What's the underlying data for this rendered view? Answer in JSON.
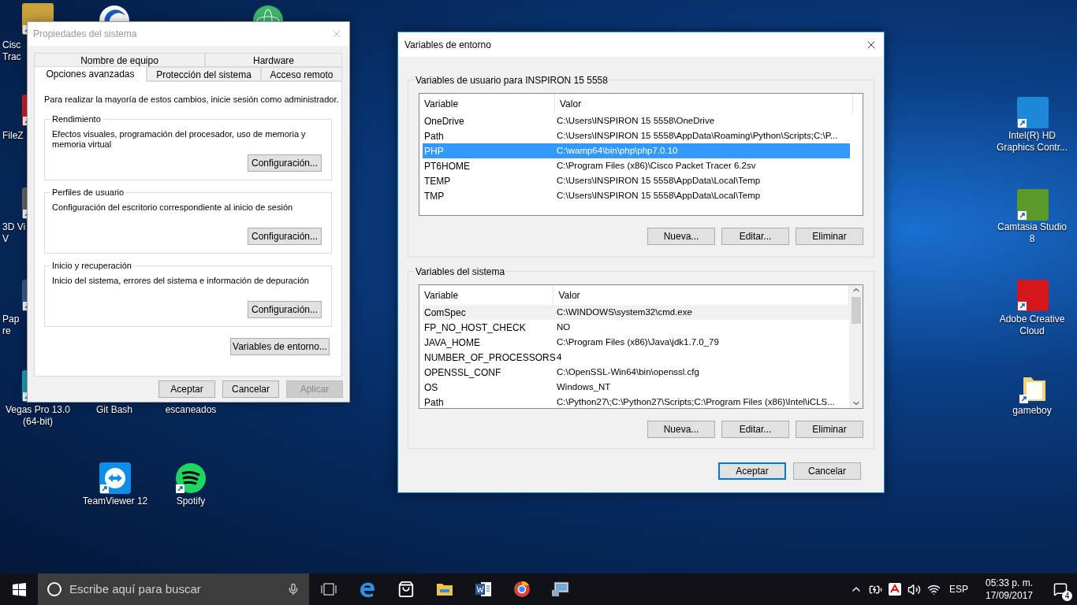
{
  "desktop_icons": [
    {
      "label_lines": [
        "Cisc",
        "Trac"
      ]
    },
    {
      "label_lines": [
        "FileZ"
      ]
    },
    {
      "label_lines": [
        "3D Vi",
        "V"
      ]
    },
    {
      "label_lines": [
        "Pap",
        "re"
      ]
    },
    {
      "label_lines": [
        "Vegas Pro 13.0",
        "(64-bit)"
      ]
    },
    {
      "label_lines": [
        "Git Bash"
      ]
    },
    {
      "label_lines": [
        "escaneados"
      ]
    },
    {
      "label_lines": [
        "TeamViewer 12"
      ]
    },
    {
      "label_lines": [
        "Spotify"
      ]
    },
    {
      "label_lines": [
        "Intel(R) HD",
        "Graphics Contr..."
      ]
    },
    {
      "label_lines": [
        "Camtasia Studio",
        "8"
      ]
    },
    {
      "label_lines": [
        "Adobe Creative",
        "Cloud"
      ]
    },
    {
      "label_lines": [
        "gameboy"
      ]
    }
  ],
  "system_properties": {
    "title": "Propiedades del sistema",
    "active": false,
    "tab_rows": [
      [
        {
          "label": "Nombre de equipo",
          "selected": false
        },
        {
          "label": "Hardware",
          "selected": false
        }
      ],
      [
        {
          "label": "Opciones avanzadas",
          "selected": true
        },
        {
          "label": "Protección del sistema",
          "selected": false
        },
        {
          "label": "Acceso remoto",
          "selected": false
        }
      ]
    ],
    "intro": "Para realizar la mayoría de estos cambios, inicie sesión como administrador.",
    "groups": [
      {
        "title": "Rendimiento",
        "description": "Efectos visuales, programación del procesador, uso de memoria y memoria virtual",
        "button": "Configuración..."
      },
      {
        "title": "Perfiles de usuario",
        "description": "Configuración del escritorio correspondiente al inicio de sesión",
        "button": "Configuración..."
      },
      {
        "title": "Inicio y recuperación",
        "description": "Inicio del sistema, errores del sistema e información de depuración",
        "button": "Configuración..."
      }
    ],
    "env_button": "Variables de entorno...",
    "buttons": [
      {
        "label": "Aceptar",
        "disabled": false
      },
      {
        "label": "Cancelar",
        "disabled": false
      },
      {
        "label": "Aplicar",
        "disabled": true
      }
    ]
  },
  "environment_variables": {
    "title": "Variables de entorno",
    "active": true,
    "sections": [
      {
        "title": "Variables de usuario para INSPIRON 15 5558",
        "focused": true,
        "columns": [
          "Variable",
          "Valor"
        ],
        "rows": [
          {
            "variable": "OneDrive",
            "value": "C:\\Users\\INSPIRON 15 5558\\OneDrive",
            "selected": false
          },
          {
            "variable": "Path",
            "value": "C:\\Users\\INSPIRON 15 5558\\AppData\\Roaming\\Python\\Scripts;C:\\P...",
            "selected": false
          },
          {
            "variable": "PHP",
            "value": "C:\\wamp64\\bin\\php\\php7.0.10",
            "selected": true
          },
          {
            "variable": "PT6HOME",
            "value": "C:\\Program Files (x86)\\Cisco Packet Tracer 6.2sv",
            "selected": false
          },
          {
            "variable": "TEMP",
            "value": "C:\\Users\\INSPIRON 15 5558\\AppData\\Local\\Temp",
            "selected": false
          },
          {
            "variable": "TMP",
            "value": "C:\\Users\\INSPIRON 15 5558\\AppData\\Local\\Temp",
            "selected": false
          }
        ],
        "buttons": [
          "Nueva...",
          "Editar...",
          "Eliminar"
        ]
      },
      {
        "title": "Variables del sistema",
        "focused": false,
        "columns": [
          "Variable",
          "Valor"
        ],
        "rows": [
          {
            "variable": "ComSpec",
            "value": "C:\\WINDOWS\\system32\\cmd.exe",
            "selected": true
          },
          {
            "variable": "FP_NO_HOST_CHECK",
            "value": "NO",
            "selected": false
          },
          {
            "variable": "JAVA_HOME",
            "value": "C:\\Program Files (x86)\\Java\\jdk1.7.0_79",
            "selected": false
          },
          {
            "variable": "NUMBER_OF_PROCESSORS",
            "value": "4",
            "selected": false
          },
          {
            "variable": "OPENSSL_CONF",
            "value": "C:\\OpenSSL-Win64\\bin\\openssl.cfg",
            "selected": false
          },
          {
            "variable": "OS",
            "value": "Windows_NT",
            "selected": false
          },
          {
            "variable": "Path",
            "value": "C:\\Python27\\;C:\\Python27\\Scripts;C:\\Program Files (x86)\\Intel\\iCLS...",
            "selected": false
          }
        ],
        "buttons": [
          "Nueva...",
          "Editar...",
          "Eliminar"
        ]
      }
    ],
    "buttons": [
      {
        "label": "Aceptar",
        "default": true
      },
      {
        "label": "Cancelar",
        "default": false
      }
    ]
  },
  "taskbar": {
    "search_placeholder": "Escribe aquí para buscar",
    "language": "ESP",
    "time": "05:33 p. m.",
    "date": "17/09/2017",
    "notification_count": "4"
  }
}
